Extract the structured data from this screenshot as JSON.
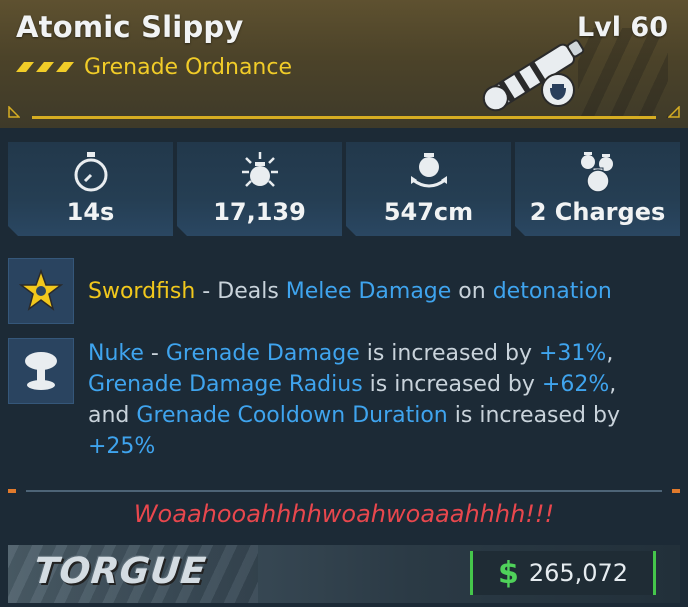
{
  "item": {
    "name": "Atomic Slippy",
    "level": "Lvl 60",
    "type": "Grenade Ordnance"
  },
  "stats": [
    {
      "icon": "stopwatch-icon",
      "value": "14s"
    },
    {
      "icon": "grenade-burst-icon",
      "value": "17,139"
    },
    {
      "icon": "grenade-radius-icon",
      "value": "547cm"
    },
    {
      "icon": "grenade-charges-icon",
      "value": "2 Charges"
    }
  ],
  "perks": {
    "swordfish": {
      "name": "Swordfish",
      "dash": " - ",
      "t1": "Deals ",
      "kw1": "Melee Damage",
      "t2": " on ",
      "kw2": "detonation"
    },
    "nuke": {
      "name": "Nuke",
      "dash": " - ",
      "kw1": "Grenade Damage",
      "t1": " is increased by ",
      "v1": "+31%",
      "c1": ",",
      "kw2": "Grenade Damage Radius",
      "t2": " is increased by ",
      "v2": "+62%",
      "c2": ",",
      "t3": "and ",
      "kw3": "Grenade Cooldown Duration",
      "t4": " is increased by",
      "v3": "+25%"
    }
  },
  "flavor_text": "Woaahooahhhhwoahwoaaahhhh!!!",
  "manufacturer": "TORGUE",
  "price": {
    "currency_symbol": "$",
    "amount": "265,072"
  },
  "colors": {
    "rarity_gold": "#f1cc28",
    "highlight_blue": "#3fa4ee",
    "flavor_red": "#e8474d",
    "money_green": "#4fd25a"
  }
}
